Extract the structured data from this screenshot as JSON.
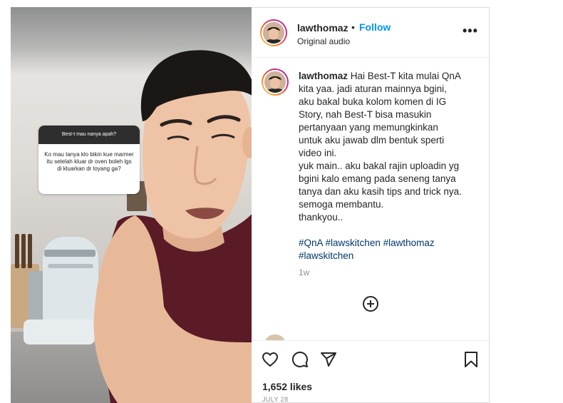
{
  "media": {
    "question_sticker": {
      "header": "Best-t mau nanya apah?",
      "question": "Ko mau tanya klo bikin kue marmer itu setelah kluar dr oven boleh lgs di kluarkan dr loyang ga?"
    }
  },
  "header": {
    "username": "lawthomaz",
    "separator": "•",
    "follow_label": "Follow",
    "audio_label": "Original audio",
    "more_icon": "more-horizontal-icon"
  },
  "caption": {
    "username": "lawthomaz",
    "lines": [
      "Hai Best-T kita mulai QnA",
      "kita yaa. jadi aturan mainnya bgini,",
      "aku bakal buka kolom komen di IG",
      "Story, nah Best-T bisa masukin",
      "pertanyaan yang memungkinkan",
      "untuk aku jawab dlm bentuk sperti",
      "video ini.",
      "yuk main.. aku bakal rajin uploadin yg",
      "bgini kalo emang pada seneng tanya",
      "tanya dan aku kasih tips and trick nya.",
      "semoga membantu.",
      "thankyou.."
    ],
    "hashtags_line1": [
      "#QnA",
      "#lawskitchen",
      "#lawthomaz"
    ],
    "hashtags_line2": [
      "#lawskitchen"
    ],
    "time": "1w"
  },
  "actions": {
    "icons": [
      "heart-icon",
      "comment-icon",
      "share-icon",
      "bookmark-icon"
    ],
    "likes": "1,652 likes",
    "date": "JULY 28"
  },
  "colors": {
    "link_blue": "#0095f6",
    "hashtag": "#00376b",
    "muted": "#8e8e8e",
    "shirt": "#5a1a26"
  }
}
